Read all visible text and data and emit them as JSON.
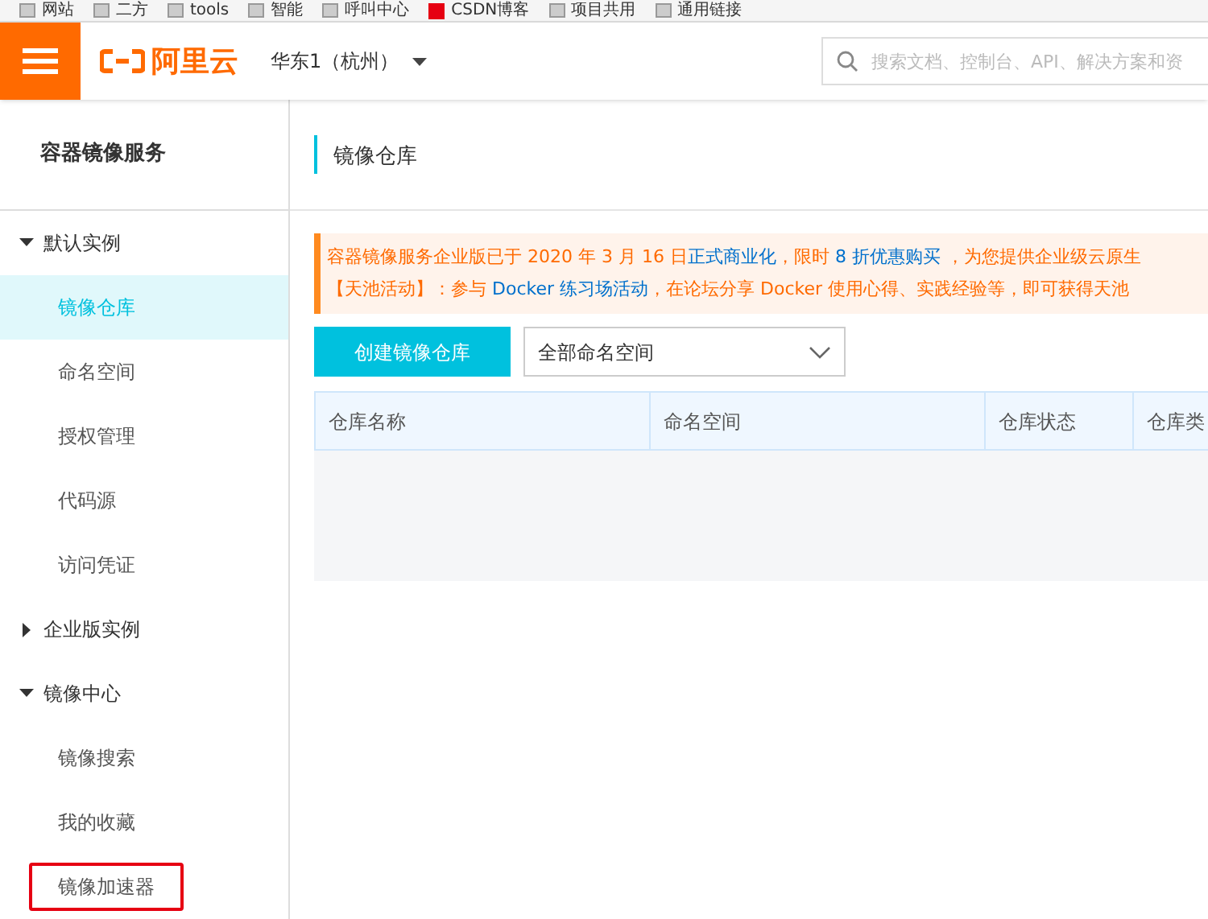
{
  "bookmarks": [
    {
      "label": "网站",
      "kind": "folder"
    },
    {
      "label": "二方",
      "kind": "folder"
    },
    {
      "label": "tools",
      "kind": "folder"
    },
    {
      "label": "智能",
      "kind": "folder"
    },
    {
      "label": "呼叫中心",
      "kind": "folder"
    },
    {
      "label": "CSDN博客",
      "kind": "site"
    },
    {
      "label": "项目共用",
      "kind": "folder"
    },
    {
      "label": "通用链接",
      "kind": "folder"
    }
  ],
  "header": {
    "logo": "阿里云",
    "region": "华东1（杭州）",
    "search": {
      "placeholder": "搜索文档、控制台、API、解决方案和资"
    }
  },
  "sidebar": {
    "title": "容器镜像服务",
    "items": [
      {
        "label": "默认实例",
        "kind": "group",
        "expanded": true,
        "children": [
          {
            "label": "镜像仓库",
            "selected": true,
            "highlighted": false
          },
          {
            "label": "命名空间",
            "selected": false,
            "highlighted": false
          },
          {
            "label": "授权管理",
            "selected": false,
            "highlighted": false
          },
          {
            "label": "代码源",
            "selected": false,
            "highlighted": false
          },
          {
            "label": "访问凭证",
            "selected": false,
            "highlighted": false
          }
        ]
      },
      {
        "label": "企业版实例",
        "kind": "group",
        "expanded": false
      },
      {
        "label": "镜像中心",
        "kind": "group",
        "expanded": true,
        "children": [
          {
            "label": "镜像搜索",
            "selected": false,
            "highlighted": false
          },
          {
            "label": "我的收藏",
            "selected": false,
            "highlighted": false
          },
          {
            "label": "镜像加速器",
            "selected": false,
            "highlighted": true
          }
        ]
      }
    ]
  },
  "page": {
    "title": "镜像仓库",
    "notice": [
      [
        {
          "text": "容器镜像服务企业版已于 2020 年 3 月 16 日",
          "kind": "text"
        },
        {
          "text": "正式商业化",
          "kind": "link"
        },
        {
          "text": "，限时 ",
          "kind": "text"
        },
        {
          "text": "8 折优惠购买",
          "kind": "link"
        },
        {
          "text": " ，为您提供企业级云原生",
          "kind": "text"
        }
      ],
      [
        {
          "text": "【天池活动】：参与 ",
          "kind": "text"
        },
        {
          "text": "Docker 练习场活动",
          "kind": "link"
        },
        {
          "text": "，在论坛分享 Docker 使用心得、实践经验等，即可获得天池",
          "kind": "text"
        }
      ]
    ],
    "create_button": "创建镜像仓库",
    "namespace_select": "全部命名空间",
    "table": {
      "columns": [
        "仓库名称",
        "命名空间",
        "仓库状态",
        "仓库类"
      ]
    }
  }
}
